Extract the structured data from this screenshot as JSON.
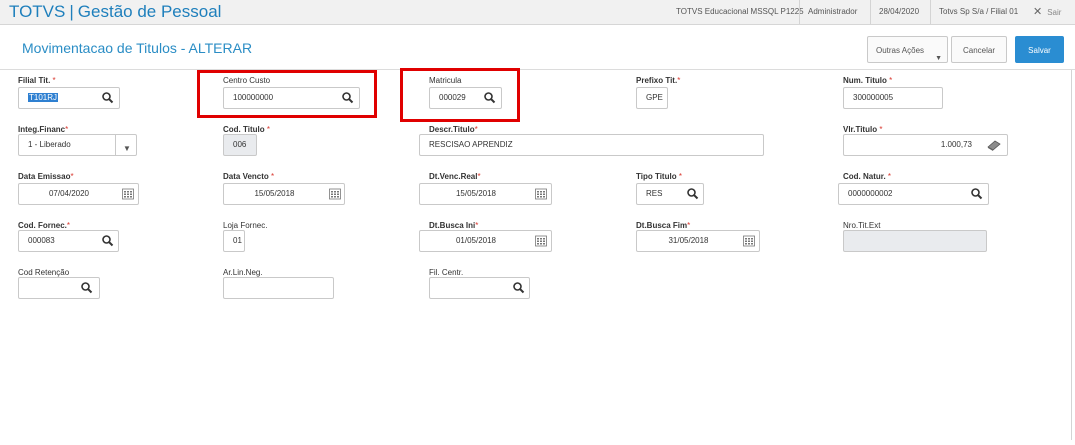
{
  "topbar": {
    "app_name": "TOTVS",
    "app_separator": "|",
    "app_module": "Gestão de Pessoal",
    "environment": "TOTVS Educacional MSSQL P1225",
    "user": "Administrador",
    "date": "28/04/2020",
    "company": "Totvs Sp S/a / Filial 01",
    "exit_label": "Sair",
    "accent_color": "#1e7fbc"
  },
  "header": {
    "title": "Movimentacao de Titulos - ALTERAR",
    "actions": {
      "other_actions_label": "Outras Ações",
      "cancel_label": "Cancelar",
      "save_label": "Salvar"
    },
    "primary_color": "#2a8dd2"
  },
  "form": {
    "filial_tit": {
      "label": "Filial Tit.",
      "required": "*",
      "value": "T101RJ",
      "icon": "search-icon"
    },
    "centro_custo": {
      "label": "Centro Custo",
      "value": "100000000",
      "icon": "search-icon",
      "highlighted": true
    },
    "matricula": {
      "label": "Matricula",
      "value": "000029",
      "icon": "search-icon",
      "highlighted": true
    },
    "prefixo_tit": {
      "label": "Prefixo Tit.",
      "required": "*",
      "value": "GPE"
    },
    "num_titulo": {
      "label": "Num. Titulo",
      "required": "*",
      "value": "300000005"
    },
    "integ_financ": {
      "label": "Integ.Financ",
      "required": "*",
      "value": "1 - Liberado",
      "icon": "chevron-down-icon"
    },
    "cod_titulo": {
      "label": "Cod. Titulo",
      "required": "*",
      "value": "006"
    },
    "descr_titulo": {
      "label": "Descr.Titulo",
      "required": "*",
      "value": "RESCISAO APRENDIZ"
    },
    "vlr_titulo": {
      "label": "Vlr.Titulo",
      "required": "*",
      "value": "1.000,73",
      "icon": "calculator-icon"
    },
    "data_emissao": {
      "label": "Data Emissao",
      "required": "*",
      "value": "07/04/2020",
      "icon": "calendar-icon"
    },
    "data_vencto": {
      "label": "Data Vencto",
      "required": "*",
      "value": "15/05/2018",
      "icon": "calendar-icon"
    },
    "dt_venc_real": {
      "label": "Dt.Venc.Real",
      "required": "*",
      "value": "15/05/2018",
      "icon": "calendar-icon"
    },
    "tipo_titulo": {
      "label": "Tipo Titulo",
      "required": "*",
      "value": "RES",
      "icon": "search-icon"
    },
    "cod_natur": {
      "label": "Cod. Natur.",
      "required": "*",
      "value": "0000000002",
      "icon": "search-icon"
    },
    "cod_fornec": {
      "label": "Cod. Fornec.",
      "required": "*",
      "value": "000083",
      "icon": "search-icon"
    },
    "loja_fornec": {
      "label": "Loja Fornec.",
      "value": "01"
    },
    "dt_busca_ini": {
      "label": "Dt.Busca Ini",
      "required": "*",
      "value": "01/05/2018",
      "icon": "calendar-icon"
    },
    "dt_busca_fim": {
      "label": "Dt.Busca Fim",
      "required": "*",
      "value": "31/05/2018",
      "icon": "calendar-icon"
    },
    "nro_tit_ext": {
      "label": "Nro.Tit.Ext",
      "value": ""
    },
    "cod_retencao": {
      "label": "Cod Retenção",
      "value": "",
      "icon": "search-icon"
    },
    "ar_lin_neg": {
      "label": "Ar.Lin.Neg.",
      "value": ""
    },
    "fil_centr": {
      "label": "Fil. Centr.",
      "value": "",
      "icon": "search-icon"
    }
  },
  "colors": {
    "required_marker": "#d9372e",
    "annotation_box": "#e00000",
    "readonly_bg": "#e9ebee"
  }
}
